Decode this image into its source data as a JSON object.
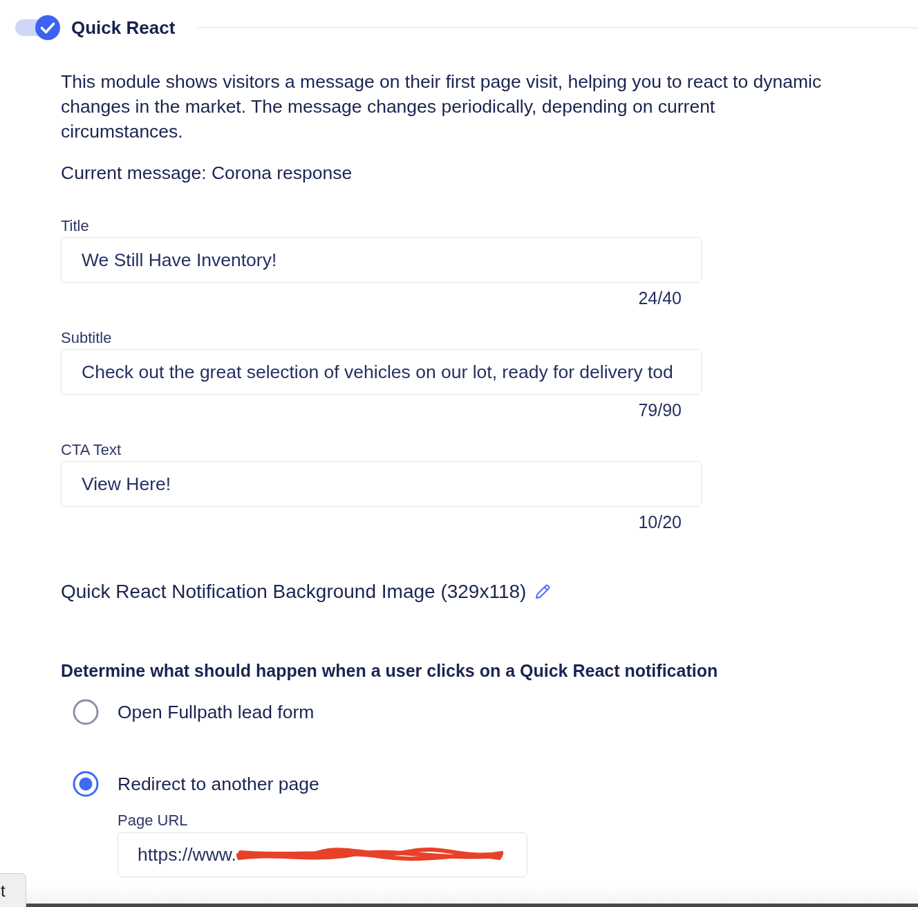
{
  "section": {
    "title": "Quick React",
    "enabled": true
  },
  "description": "This module shows visitors a message on their first page visit, helping you to react to dynamic changes in the market. The message changes periodically, depending on current circumstances.",
  "current_message": "Current message: Corona response",
  "fields": [
    {
      "label": "Title",
      "value": "We Still Have Inventory!",
      "counter": "24/40"
    },
    {
      "label": "Subtitle",
      "value": "Check out the great selection of vehicles on our lot, ready for delivery tod",
      "counter": "79/90"
    },
    {
      "label": "CTA Text",
      "value": "View Here!",
      "counter": "10/20"
    }
  ],
  "background_image": {
    "label": "Quick React Notification Background Image (329x118)"
  },
  "click_action": {
    "prompt": "Determine what should happen when a user clicks on a Quick React notification",
    "options": [
      {
        "label": "Open Fullpath lead form",
        "selected": false
      },
      {
        "label": "Redirect to another page",
        "selected": true
      }
    ]
  },
  "page_url": {
    "label": "Page URL",
    "value": "https://www.",
    "redacted": true
  },
  "bottom_tab": {
    "label": "t"
  }
}
